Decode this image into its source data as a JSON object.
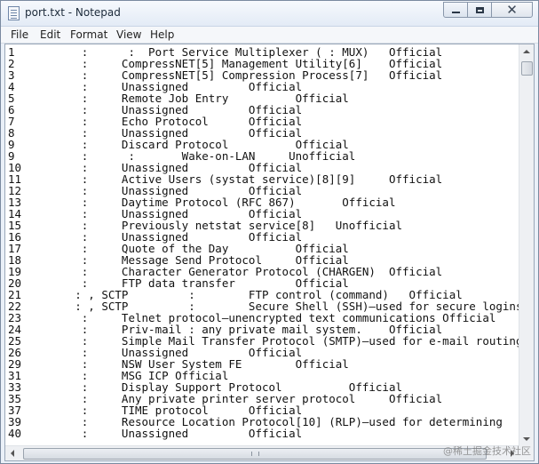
{
  "window": {
    "title": "port.txt - Notepad",
    "icon": "notepad-icon"
  },
  "window_controls": {
    "minimize": "minimize-icon",
    "maximize": "maximize-icon",
    "close": "✕"
  },
  "menu": [
    "File",
    "Edit",
    "Format",
    "View",
    "Help"
  ],
  "lines": [
    "1          :      :  Port Service Multiplexer ( : MUX)   Official",
    "2          :     CompressNET[5] Management Utility[6]    Official",
    "3          :     CompressNET[5] Compression Process[7]   Official",
    "4          :     Unassigned         Official",
    "5          :     Remote Job Entry          Official",
    "6          :     Unassigned         Official",
    "7          :     Echo Protocol      Official",
    "8          :     Unassigned         Official",
    "9          :     Discard Protocol          Official",
    "9          :      :       Wake-on-LAN     Unofficial",
    "10         :     Unassigned         Official",
    "11         :     Active Users (systat service)[8][9]     Official",
    "12         :     Unassigned         Official",
    "13         :     Daytime Protocol (RFC 867)       Official",
    "14         :     Unassigned         Official",
    "15         :     Previously netstat service[8]   Unofficial",
    "16         :     Unassigned         Official",
    "17         :     Quote of the Day          Official",
    "18         :     Message Send Protocol     Official",
    "19         :     Character Generator Protocol (CHARGEN)  Official",
    "20         :     FTP data transfer         Official",
    "21        : , SCTP         :        FTP control (command)   Official",
    "22        : , SCTP         :        Secure Shell (SSH)—used for secure logins",
    "23         :     Telnet protocol—unencrypted text communications Official",
    "24         :     Priv-mail : any private mail system.    Official",
    "25         :     Simple Mail Transfer Protocol (SMTP)—used for e-mail routing",
    "26         :     Unassigned         Official",
    "29         :     NSW User System FE        Official",
    "31         :     MSG ICP Official",
    "33         :     Display Support Protocol          Official",
    "35         :     Any private printer server protocol     Official",
    "37         :     TIME protocol      Official",
    "39         :     Resource Location Protocol[10] (RLP)—used for determining",
    "40         :     Unassigned         Official"
  ],
  "watermark": "@稀土掘金技术社区"
}
